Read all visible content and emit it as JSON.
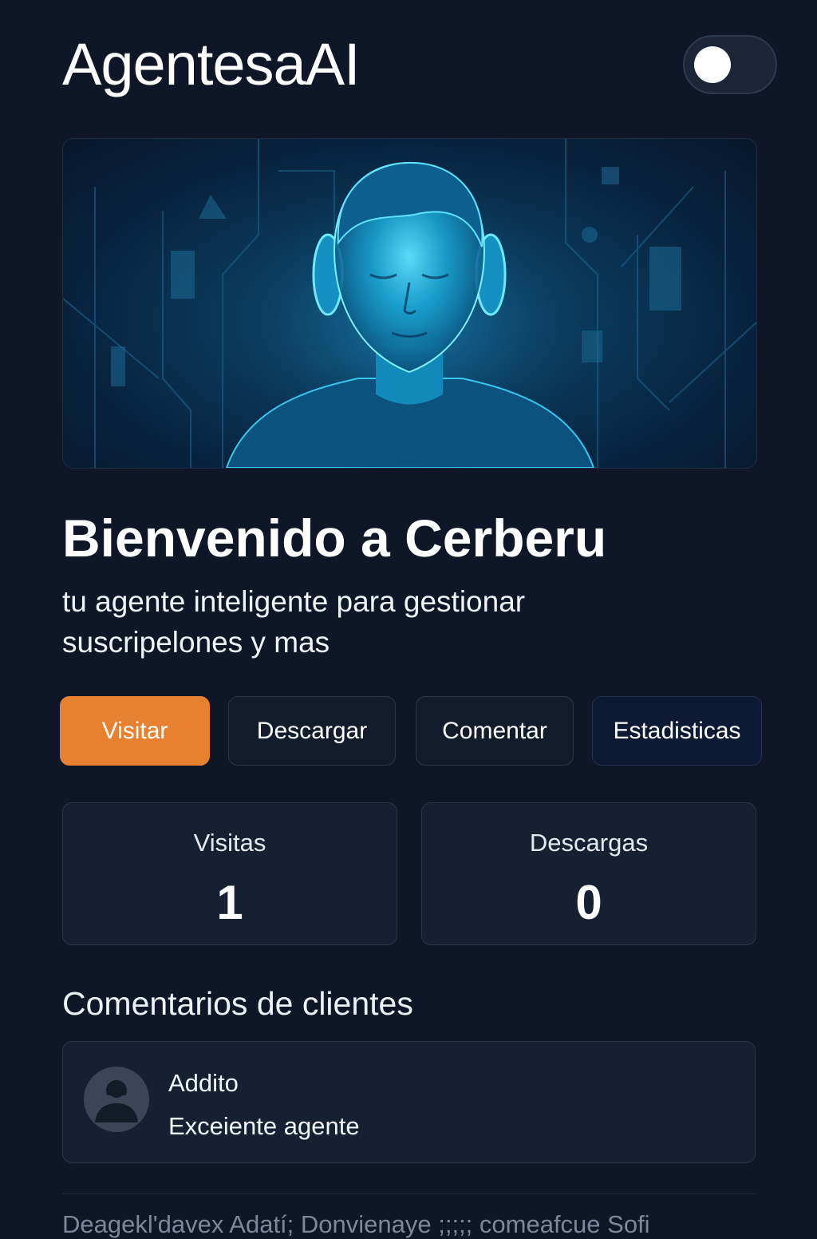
{
  "header": {
    "app_title": "AgentesaAI",
    "theme_toggle": "off"
  },
  "hero": {
    "image": "glowing-ai-agent-portrait"
  },
  "welcome": {
    "title": "Bienvenido a Cerberu",
    "subtitle": "tu agente inteligente para gestionar suscripelones y mas"
  },
  "actions": {
    "visit_label": "Visitar",
    "download_label": "Descargar",
    "comment_label": "Comentar",
    "stats_label": "Estadisticas"
  },
  "stats": {
    "visits_label": "Visitas",
    "visits_value": "1",
    "downloads_label": "Descargas",
    "downloads_value": "0"
  },
  "comments": {
    "section_title": "Comentarios de clientes",
    "items": [
      {
        "author": "Addito",
        "text": "Exceiente agente",
        "avatar": "user-avatar-icon"
      }
    ]
  },
  "footer": {
    "text": "Deagekl'davex Adatí; Donvienaye ;;;;; comeafcue Sofi"
  },
  "colors": {
    "background": "#0e1628",
    "primary_button": "#e8812f",
    "card": "#172033"
  }
}
